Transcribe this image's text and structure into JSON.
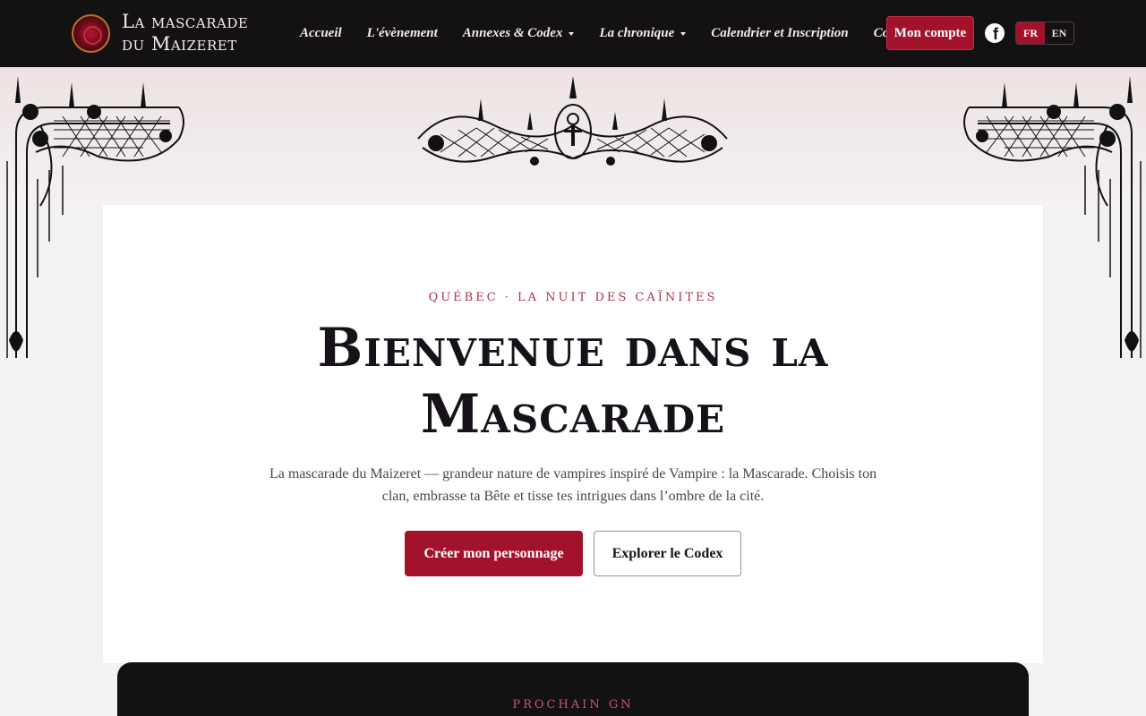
{
  "site": {
    "brand_line1": "La mascarade",
    "brand_line2": "du Maizeret"
  },
  "nav": {
    "items": [
      {
        "label": "Accueil",
        "dropdown": false
      },
      {
        "label": "L'évènement",
        "dropdown": false
      },
      {
        "label": "Annexes & Codex",
        "dropdown": true
      },
      {
        "label": "La chronique",
        "dropdown": true
      },
      {
        "label": "Calendrier et Inscription",
        "dropdown": false
      },
      {
        "label": "Contact",
        "dropdown": false
      }
    ],
    "account_label": "Mon compte",
    "social_icon": "facebook-icon",
    "languages": {
      "active": "FR",
      "other": "EN"
    }
  },
  "hero": {
    "kicker": "QUÉBEC · LA NUIT DES CAÏNITES",
    "title_line1": "Bienvenue dans la",
    "title_line2": "Mascarade",
    "lead": "La mascarade du Maizeret — grandeur nature de vampires inspiré de Vampire : la Mascarade. Choisis ton clan, embrasse ta Bête et tisse tes intrigues dans l’ombre de la cité.",
    "primary_cta": "Créer mon personnage",
    "secondary_cta": "Explorer le Codex"
  },
  "next_event": {
    "label": "PROCHAIN GN"
  },
  "colors": {
    "accent": "#a3122b",
    "header_bg": "#141112",
    "page_bg": "#f4f2f1",
    "kicker": "#a8334a"
  }
}
